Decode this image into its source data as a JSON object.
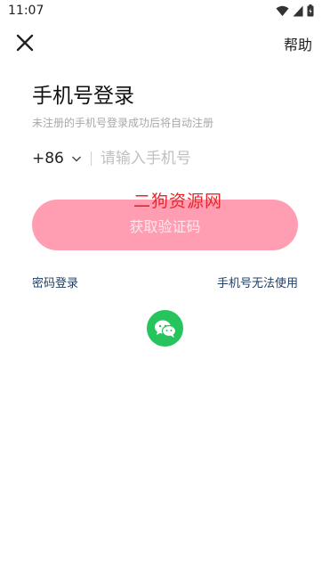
{
  "status_bar": {
    "time": "11:07"
  },
  "header": {
    "help_label": "帮助"
  },
  "login": {
    "title": "手机号登录",
    "subtitle": "未注册的手机号登录成功后将自动注册",
    "country_code": "+86",
    "phone_placeholder": "请输入手机号",
    "phone_value": "",
    "get_code_label": "获取验证码"
  },
  "watermark": "二狗资源网",
  "links": {
    "password_login": "密码登录",
    "phone_unavailable": "手机号无法使用"
  },
  "icons": {
    "close": "close-icon",
    "wechat": "wechat-icon",
    "wifi": "wifi-icon",
    "signal": "signal-icon",
    "battery": "battery-icon",
    "chevron": "chevron-down-icon"
  },
  "colors": {
    "button_bg": "#ff9eb3",
    "wechat_green": "#25c45d",
    "link": "#1f3f66",
    "watermark": "#e8262a"
  }
}
